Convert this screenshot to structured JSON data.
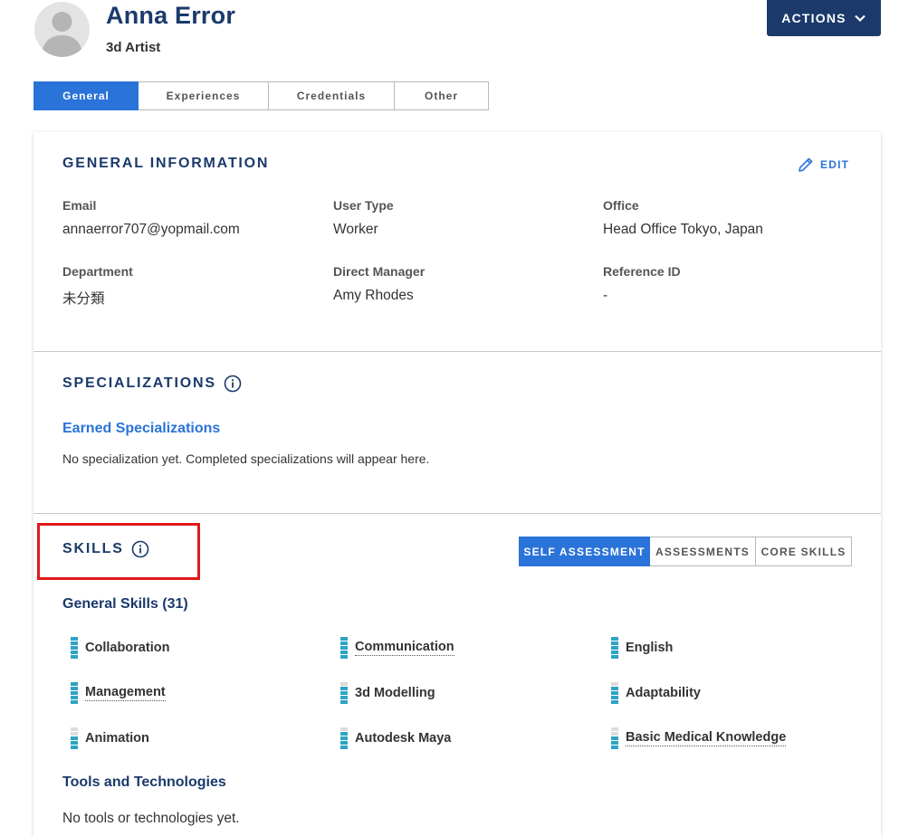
{
  "header": {
    "name": "Anna Error",
    "title": "3d Artist",
    "actions_label": "ACTIONS"
  },
  "tabs": [
    {
      "label": "General",
      "active": true
    },
    {
      "label": "Experiences",
      "active": false
    },
    {
      "label": "Credentials",
      "active": false
    },
    {
      "label": "Other",
      "active": false
    }
  ],
  "general_info": {
    "title": "GENERAL INFORMATION",
    "edit_label": "EDIT",
    "fields": [
      {
        "label": "Email",
        "value": "annaerror707@yopmail.com"
      },
      {
        "label": "User Type",
        "value": "Worker"
      },
      {
        "label": "Office",
        "value": "Head Office Tokyo, Japan"
      },
      {
        "label": "Department",
        "value": "未分類"
      },
      {
        "label": "Direct Manager",
        "value": "Amy Rhodes"
      },
      {
        "label": "Reference ID",
        "value": "-"
      }
    ]
  },
  "specializations": {
    "title": "SPECIALIZATIONS",
    "earned_heading": "Earned Specializations",
    "empty_text": "No specialization yet. Completed specializations will appear here."
  },
  "skills": {
    "title": "SKILLS",
    "segments": [
      {
        "label": "SELF ASSESSMENT",
        "active": true
      },
      {
        "label": "ASSESSMENTS",
        "active": false
      },
      {
        "label": "CORE SKILLS",
        "active": false
      }
    ],
    "general_heading": "General Skills (31)",
    "items": [
      {
        "label": "Collaboration",
        "level": 5,
        "max": 5,
        "dotted": false
      },
      {
        "label": "Communication",
        "level": 5,
        "max": 5,
        "dotted": true
      },
      {
        "label": "English",
        "level": 5,
        "max": 5,
        "dotted": false
      },
      {
        "label": "Management",
        "level": 5,
        "max": 5,
        "dotted": true
      },
      {
        "label": "3d Modelling",
        "level": 4,
        "max": 5,
        "dotted": false
      },
      {
        "label": "Adaptability",
        "level": 4,
        "max": 5,
        "dotted": false
      },
      {
        "label": "Animation",
        "level": 3,
        "max": 5,
        "dotted": false
      },
      {
        "label": "Autodesk Maya",
        "level": 4,
        "max": 5,
        "dotted": false
      },
      {
        "label": "Basic Medical Knowledge",
        "level": 3,
        "max": 5,
        "dotted": true
      }
    ],
    "tools_heading": "Tools and Technologies",
    "tools_empty": "No tools or technologies yet."
  },
  "colors": {
    "navy": "#1b3a6b",
    "blue": "#2a73d8",
    "skill_bar": "#2ea3c4",
    "highlight": "#e0191b"
  }
}
